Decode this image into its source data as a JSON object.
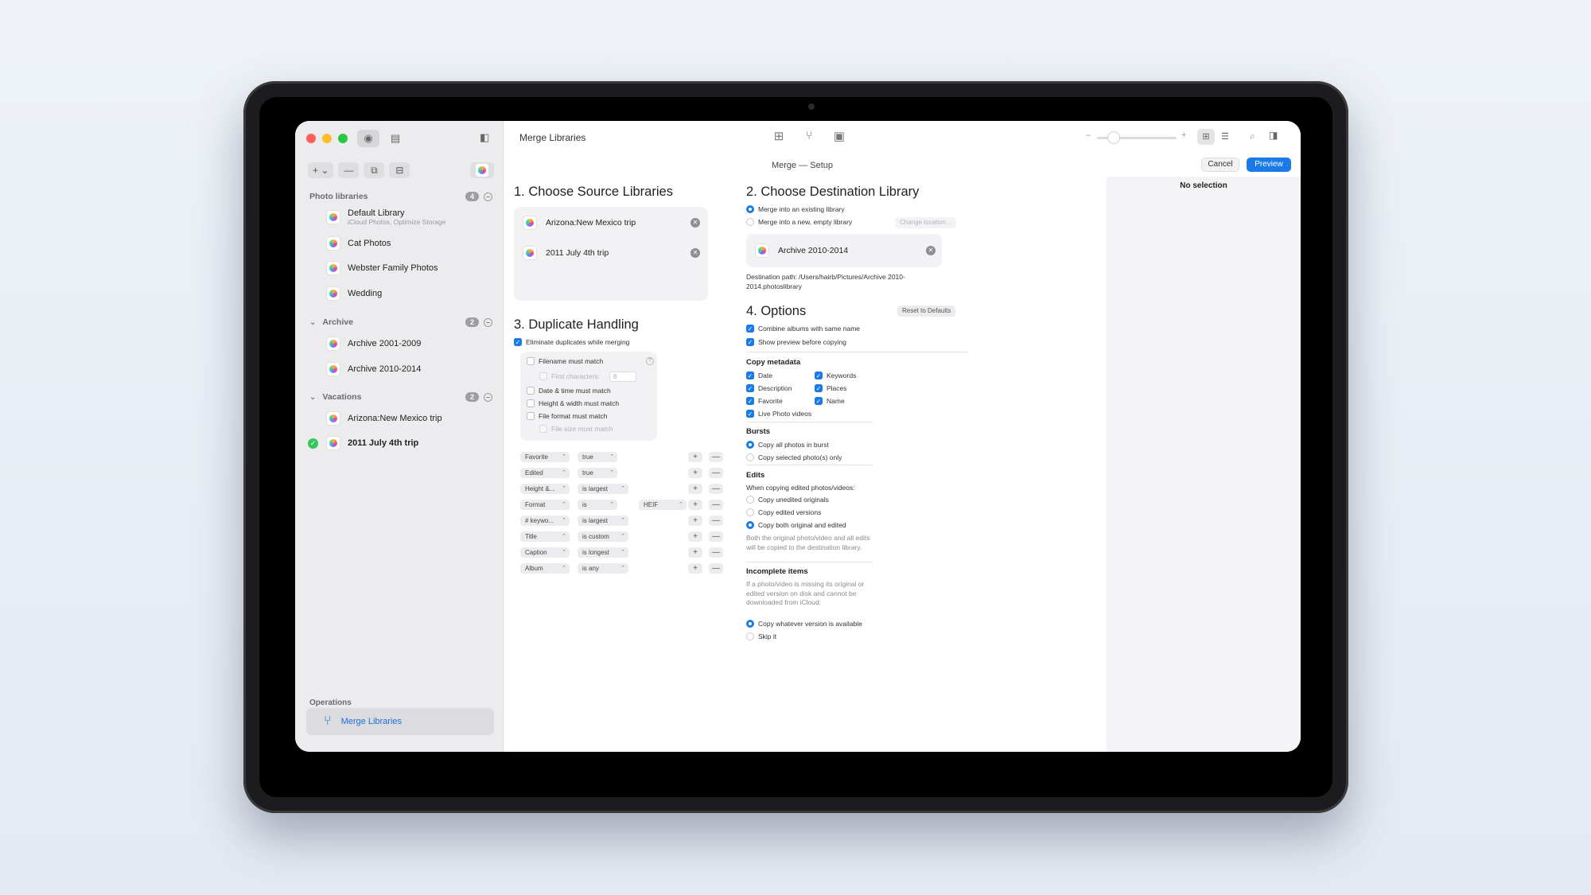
{
  "window": {
    "title": "Merge Libraries"
  },
  "sidebar": {
    "photo_libraries": {
      "label": "Photo libraries",
      "count": "4",
      "items": [
        {
          "name": "Default Library",
          "sub": "iCloud Photos, Optimize Storage"
        },
        {
          "name": "Cat Photos"
        },
        {
          "name": "Webster Family Photos"
        },
        {
          "name": "Wedding"
        }
      ]
    },
    "archive": {
      "label": "Archive",
      "count": "2",
      "items": [
        {
          "name": "Archive 2001-2009"
        },
        {
          "name": "Archive 2010-2014"
        }
      ]
    },
    "vacations": {
      "label": "Vacations",
      "count": "2",
      "items": [
        {
          "name": "Arizona:New Mexico trip"
        },
        {
          "name": "2011 July 4th trip"
        }
      ]
    },
    "operations": {
      "label": "Operations",
      "item": "Merge Libraries"
    },
    "toolbar": {
      "add": "+ ⌄",
      "remove": "—"
    }
  },
  "header": {
    "title": "Merge — Setup",
    "cancel": "Cancel",
    "preview": "Preview",
    "zoom_minus": "–",
    "zoom_plus": "+"
  },
  "inspector": {
    "empty": "No selection"
  },
  "source": {
    "heading": "1. Choose Source Libraries",
    "items": [
      "Arizona:New Mexico trip",
      "2011 July 4th trip"
    ]
  },
  "destination": {
    "heading": "2. Choose Destination Library",
    "option_existing": "Merge into an existing library",
    "option_new": "Merge into a new, empty library",
    "change_location": "Change location...",
    "library": "Archive 2010-2014",
    "path": "Destination path: /Users/hairb/Pictures/Archive 2010-2014.photoslibrary"
  },
  "duplicates": {
    "heading": "3. Duplicate Handling",
    "eliminate": "Eliminate duplicates while merging",
    "filename": "Filename must match",
    "first_chars": "First characters:",
    "first_chars_value": "8",
    "datetime": "Date & time must match",
    "heightwidth": "Height & width must match",
    "fileformat": "File format must match",
    "filesize": "File size must match",
    "rules": [
      {
        "field": "Favorite",
        "op": "true",
        "value": ""
      },
      {
        "field": "Edited",
        "op": "true",
        "value": ""
      },
      {
        "field": "Height &...",
        "op": "is largest",
        "value": ""
      },
      {
        "field": "Format",
        "op": "is",
        "value": "HEIF"
      },
      {
        "field": "# keywo...",
        "op": "is largest",
        "value": ""
      },
      {
        "field": "Title",
        "op": "is custom",
        "value": ""
      },
      {
        "field": "Caption",
        "op": "is longest",
        "value": ""
      },
      {
        "field": "Album",
        "op": "is any",
        "value": ""
      }
    ],
    "plus": "+",
    "minus": "—"
  },
  "options": {
    "heading": "4. Options",
    "reset": "Reset to Defaults",
    "combine": "Combine albums with same name",
    "show_preview": "Show preview before copying",
    "copy_metadata": {
      "label": "Copy metadata",
      "date": "Date",
      "keywords": "Keywords",
      "description": "Description",
      "places": "Places",
      "favorite": "Favorite",
      "name": "Name",
      "live": "Live Photo videos"
    },
    "bursts": {
      "label": "Bursts",
      "all": "Copy all photos in burst",
      "selected": "Copy selected photo(s) only"
    },
    "edits": {
      "label": "Edits",
      "when": "When copying edited photos/videos:",
      "unedited": "Copy unedited originals",
      "edited": "Copy edited versions",
      "both": "Copy both original and edited",
      "note": "Both the original photo/video and all edits will be copied to the destination library."
    },
    "incomplete": {
      "label": "Incomplete items",
      "note": "If a photo/video is missing its original or edited version on disk and cannot be downloaded from iCloud:",
      "copy_whatever": "Copy whatever version is available",
      "skip": "Skip it"
    }
  }
}
